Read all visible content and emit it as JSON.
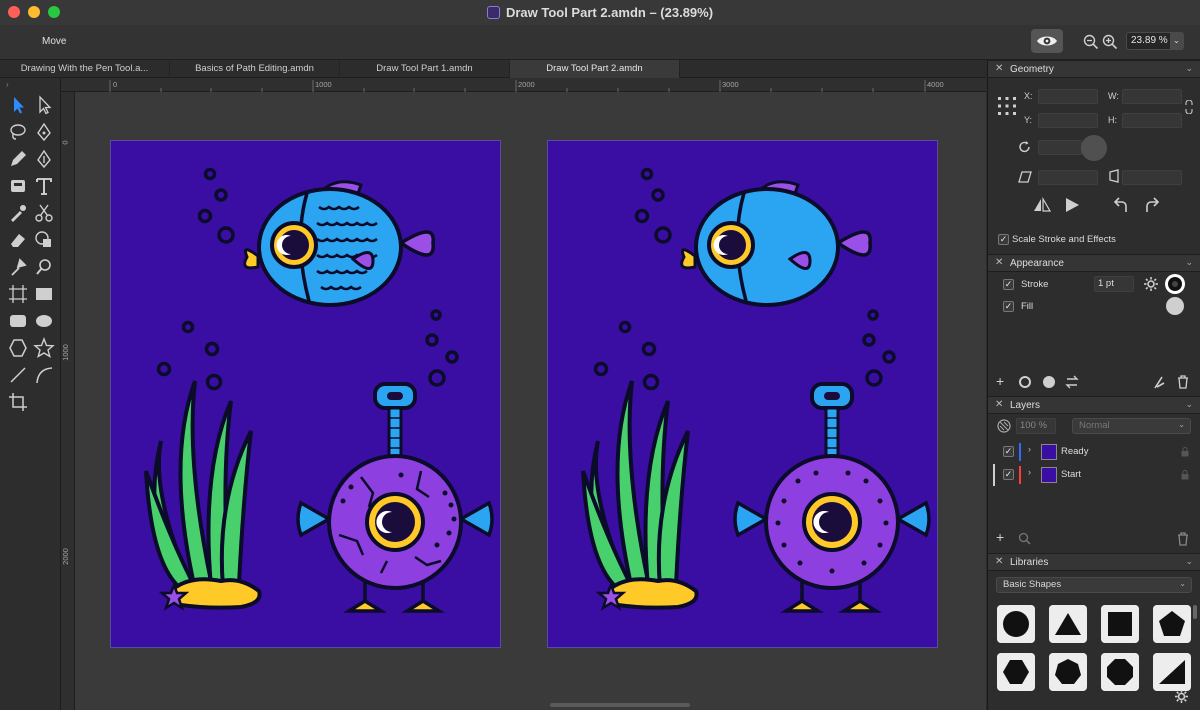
{
  "window": {
    "title": "Draw Tool Part 2.amdn – (23.89%)"
  },
  "toolbar": {
    "mode_label": "Move",
    "zoom_value": "23.89 %"
  },
  "tabs": [
    {
      "label": "Drawing With the Pen Tool.a..."
    },
    {
      "label": "Basics of Path Editing.amdn"
    },
    {
      "label": "Draw Tool Part 1.amdn"
    },
    {
      "label": "Draw Tool Part 2.amdn"
    }
  ],
  "rulers": {
    "unit": "px",
    "h_labels": [
      "0",
      "1000",
      "2000",
      "3000",
      "4000"
    ],
    "v_labels": [
      "0",
      "1000",
      "2000"
    ]
  },
  "tools": [
    "move-tool",
    "direct-select-tool",
    "lasso-tool",
    "pen-tool",
    "pencil-tool",
    "vector-brush-tool",
    "fill-tool",
    "text-tool",
    "eyedropper-tool",
    "scissors-tool",
    "eraser-tool",
    "shape-builder-tool",
    "color-picker-tool",
    "zoom-tool",
    "artboard-tool",
    "rectangle-tool",
    "rounded-rect-tool",
    "ellipse-tool",
    "polygon-tool",
    "star-tool",
    "line-tool",
    "arc-tool",
    "crop-tool"
  ],
  "geometry": {
    "header": "Geometry",
    "x_label": "X:",
    "y_label": "Y:",
    "w_label": "W:",
    "h_label": "H:",
    "scale_stroke_label": "Scale Stroke and Effects"
  },
  "appearance": {
    "header": "Appearance",
    "stroke_label": "Stroke",
    "stroke_value": "1 pt",
    "fill_label": "Fill"
  },
  "layers": {
    "header": "Layers",
    "opacity": "100 %",
    "blend_mode": "Normal",
    "items": [
      {
        "name": "Ready",
        "color": "#2f6bff"
      },
      {
        "name": "Start",
        "color": "#ff3b3b"
      }
    ]
  },
  "libraries": {
    "header": "Libraries",
    "selected": "Basic Shapes",
    "shapes": [
      "circle-shape",
      "triangle-shape",
      "square-shape",
      "pentagon-shape",
      "hexagon-shape",
      "heptagon-shape",
      "octagon-shape",
      "wedge-shape"
    ]
  },
  "colors": {
    "artboard": "#3a0ea3",
    "fish_body": "#2ba4f2",
    "creature_body": "#8e3fe0",
    "seaweed": "#47d06b",
    "eye_yellow": "#ffc928"
  }
}
